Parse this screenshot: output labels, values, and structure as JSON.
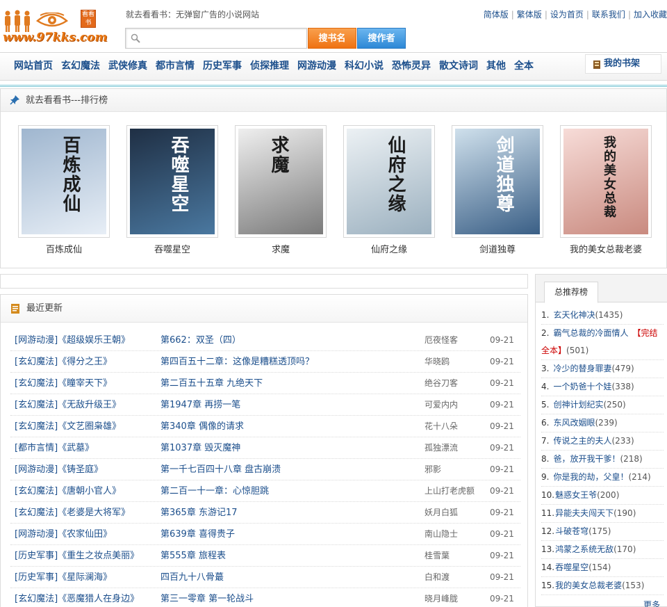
{
  "header": {
    "logo_url_text": "www.97kks.com",
    "logo_seal_text": "看看书",
    "slogan": "就去看看书：无弹窗广告的小说网站",
    "links": [
      "简体版",
      "繁体版",
      "设为首页",
      "联系我们",
      "加入收藏"
    ],
    "search_placeholder": "",
    "btn_search_book": "搜书名",
    "btn_search_author": "搜作者"
  },
  "nav": {
    "items": [
      "网站首页",
      "玄幻魔法",
      "武侠修真",
      "都市言情",
      "历史军事",
      "侦探推理",
      "网游动漫",
      "科幻小说",
      "恐怖灵异",
      "散文诗词",
      "其他",
      "全本"
    ],
    "shelf": "我的书架"
  },
  "ranking": {
    "title": "就去看看书---排行榜",
    "books": [
      {
        "name": "百炼成仙",
        "cover_text": "百炼成仙",
        "cover_colors": [
          "#9fb6cf",
          "#e7eef6"
        ]
      },
      {
        "name": "吞噬星空",
        "cover_text": "吞噬星空",
        "cover_colors": [
          "#1f2f44",
          "#4a78a0"
        ]
      },
      {
        "name": "求魔",
        "cover_text": "求魔",
        "cover_colors": [
          "#efefef",
          "#7a7a7a"
        ]
      },
      {
        "name": "仙府之缘",
        "cover_text": "仙府之缘",
        "cover_colors": [
          "#ecf1f4",
          "#9bb0bf"
        ]
      },
      {
        "name": "剑道独尊",
        "cover_text": "剑道独尊",
        "cover_colors": [
          "#cfe0ec",
          "#3a5f86"
        ]
      },
      {
        "name": "我的美女总裁老婆",
        "cover_text": "我的美女总裁",
        "cover_colors": [
          "#f7dcd8",
          "#c98a7f"
        ]
      }
    ]
  },
  "recent": {
    "title": "最近更新",
    "rows": [
      {
        "cat": "[网游动漫]《超级娱乐王朝》",
        "chapter": "第662：双圣（四）",
        "author": "厄夜怪客",
        "date": "09-21"
      },
      {
        "cat": "[玄幻魔法]《得分之王》",
        "chapter": "第四百五十二章：这像是糟糕透顶吗？",
        "author": "华晓鸥",
        "date": "09-21"
      },
      {
        "cat": "[玄幻魔法]《瞳宰天下》",
        "chapter": "第二百五十五章 九绝天下",
        "author": "绝谷刀客",
        "date": "09-21"
      },
      {
        "cat": "[玄幻魔法]《无敌升级王》",
        "chapter": "第1947章 再捞一笔",
        "author": "可爱内内",
        "date": "09-21"
      },
      {
        "cat": "[玄幻魔法]《文艺圈枭雄》",
        "chapter": "第340章 偶像的请求",
        "author": "花十八朵",
        "date": "09-21"
      },
      {
        "cat": "[都市言情]《武墓》",
        "chapter": "第1037章 毁灭魔神",
        "author": "孤独漂流",
        "date": "09-21"
      },
      {
        "cat": "[网游动漫]《铸圣庭》",
        "chapter": "第一千七百四十八章 盘古崩溃",
        "author": "邪影",
        "date": "09-21"
      },
      {
        "cat": "[玄幻魔法]《唐朝小官人》",
        "chapter": "第二百一十一章：心惊胆跳",
        "author": "上山打老虎额",
        "date": "09-21"
      },
      {
        "cat": "[玄幻魔法]《老婆是大将军》",
        "chapter": "第365章 东游记17",
        "author": "妖月白狐",
        "date": "09-21"
      },
      {
        "cat": "[网游动漫]《农家仙田》",
        "chapter": "第639章 喜得贵子",
        "author": "南山隐士",
        "date": "09-21"
      },
      {
        "cat": "[历史军事]《重生之妆点美丽》",
        "chapter": "第555章 旅程表",
        "author": "桂雪葉",
        "date": "09-21"
      },
      {
        "cat": "[历史军事]《星际澜海》",
        "chapter": "四百九十八骨蕞",
        "author": "白和渡",
        "date": "09-21"
      },
      {
        "cat": "[玄幻魔法]《恶魔猎人在身边》",
        "chapter": "第三一零章 第一轮战斗",
        "author": "晓月峰胧",
        "date": "09-21"
      }
    ]
  },
  "side": {
    "tab": "总推荐榜",
    "items": [
      {
        "n": "1.",
        "title": "玄天化神决",
        "count": "(1435)"
      },
      {
        "n": "2.",
        "title": "霸气总裁的冷面情人",
        "tag": "【完结全本】",
        "count": "(501)"
      },
      {
        "n": "3.",
        "title": "冷少的替身罪妻",
        "count": "(479)"
      },
      {
        "n": "4.",
        "title": "一个奶爸十个娃",
        "count": "(338)"
      },
      {
        "n": "5.",
        "title": "创神计划纪实",
        "count": "(250)"
      },
      {
        "n": "6.",
        "title": "东风改姻眼",
        "count": "(239)"
      },
      {
        "n": "7.",
        "title": "传说之主的夫人",
        "count": "(233)"
      },
      {
        "n": "8.",
        "title": "爸，放开我干爹！",
        "count": "(218)"
      },
      {
        "n": "9.",
        "title": "你是我的劫，父皇！",
        "count": "(214)"
      },
      {
        "n": "10.",
        "title": "魅惑女王爷",
        "count": "(200)"
      },
      {
        "n": "11.",
        "title": "异能夫夫闯天下",
        "count": "(190)"
      },
      {
        "n": "12.",
        "title": "斗破苍穹",
        "count": "(175)"
      },
      {
        "n": "13.",
        "title": "鸿蒙之系统无敌",
        "count": "(170)"
      },
      {
        "n": "14.",
        "title": "吞噬星空",
        "count": "(154)"
      },
      {
        "n": "15.",
        "title": "我的美女总裁老婆",
        "count": "(153)"
      }
    ],
    "more": "更多"
  },
  "colors": {
    "link": "#1c4f8c",
    "orange": "#ef7212",
    "blue": "#2d88d6",
    "accent_line": "#7cc7d6"
  }
}
